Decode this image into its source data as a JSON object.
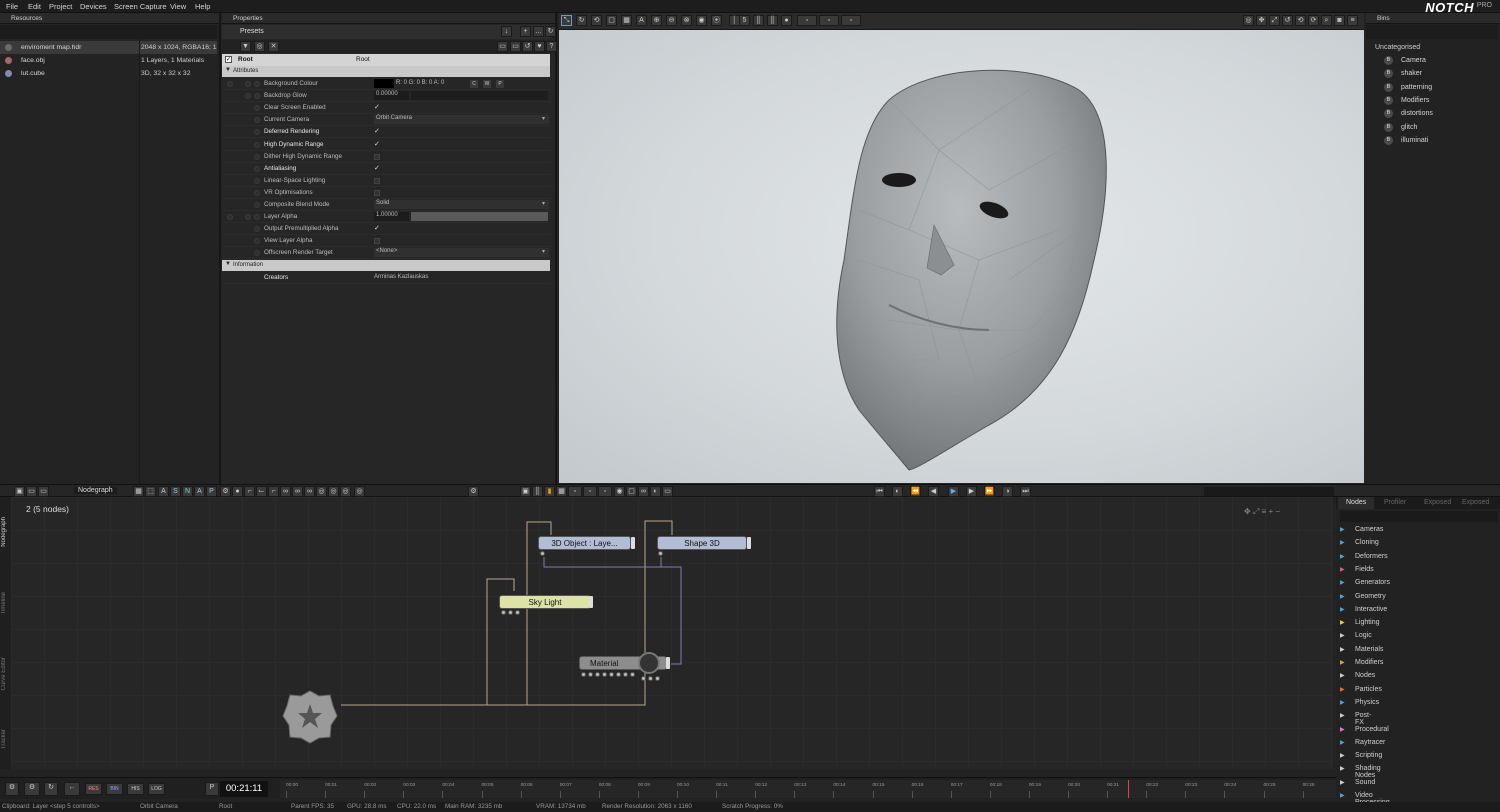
{
  "menu": [
    "File",
    "Edit",
    "Project",
    "Devices",
    "Screen Capture",
    "View",
    "Help"
  ],
  "logo": "NOTCH",
  "logo_sub": "PRO",
  "resources": {
    "title": "Resources",
    "items": [
      {
        "name": "enviroment map.hdr",
        "info": "2048 x 1024, RGBA16; 1"
      },
      {
        "name": "face.obj",
        "info": "1 Layers, 1 Materials"
      },
      {
        "name": "lut.cube",
        "info": "3D, 32 x 32 x 32"
      }
    ]
  },
  "properties": {
    "title": "Properties",
    "presets": "Presets",
    "root_label": "Root",
    "root_value": "Root",
    "attributes_header": "Attributes",
    "rows": [
      {
        "label": "Background Colour",
        "value": "R: 0 G: 0 B: 0 A: 0",
        "bold": false
      },
      {
        "label": "Backdrop Glow",
        "value": "0.00000",
        "bold": false
      },
      {
        "label": "Clear Screen Enabled",
        "value": "✓",
        "bold": false
      },
      {
        "label": "Current Camera",
        "value": "Orbit Camera",
        "bold": false
      },
      {
        "label": "Deferred Rendering",
        "value": "✓",
        "bold": true
      },
      {
        "label": "High Dynamic Range",
        "value": "✓",
        "bold": true
      },
      {
        "label": "Dither High Dynamic Range",
        "value": "",
        "bold": false
      },
      {
        "label": "Antialiasing",
        "value": "✓",
        "bold": true
      },
      {
        "label": "Linear-Space Lighting",
        "value": "",
        "bold": false
      },
      {
        "label": "VR Optimisations",
        "value": "",
        "bold": false
      },
      {
        "label": "Composite Blend Mode",
        "value": "Solid",
        "bold": false
      },
      {
        "label": "Layer Alpha",
        "value": "1.00000",
        "bold": false
      },
      {
        "label": "Output Premultiplied Alpha",
        "value": "✓",
        "bold": false
      },
      {
        "label": "View Layer Alpha",
        "value": "",
        "bold": false
      },
      {
        "label": "Offscreen Render Target",
        "value": "<None>",
        "bold": false
      }
    ],
    "color_btns": [
      "C",
      "W",
      "P"
    ],
    "information_header": "Information",
    "creators_label": "Creators",
    "creators_value": "Arminas Kazlauskas"
  },
  "viewport_toolbar": {
    "num": "5"
  },
  "bins": {
    "title": "Bins",
    "uncategorised": "Uncategorised",
    "items": [
      "Camera",
      "shaker",
      "patterning",
      "Modifiers",
      "distortions",
      "glitch",
      "illuminati"
    ],
    "badge": "B"
  },
  "nodegraph": {
    "tab": "Nodegraph",
    "toolbar_letters": [
      "S",
      "N",
      "A",
      "P"
    ],
    "counter": "2  (5  nodes)",
    "nodes": [
      {
        "label": "3D  Object  :  Laye...",
        "color": "#a9b5cf"
      },
      {
        "label": "Shape  3D",
        "color": "#a9b5cf"
      },
      {
        "label": "Sky  Light",
        "color": "#d9dca0"
      },
      {
        "label": "Material",
        "color": "#8a8a8a"
      }
    ],
    "vtabs": [
      "Nodegraph",
      "Timeline",
      "Curve Editor",
      "Tracker"
    ]
  },
  "nodes_panel": {
    "tabs": [
      "Nodes",
      "Profiler",
      "Exposed",
      "Exposed"
    ],
    "items": [
      {
        "label": "Cameras",
        "color": "#4aa3df"
      },
      {
        "label": "Cloning",
        "color": "#4aa3df"
      },
      {
        "label": "Deformers",
        "color": "#4aa3df"
      },
      {
        "label": "Fields",
        "color": "#e05a8a"
      },
      {
        "label": "Generators",
        "color": "#4aa3df"
      },
      {
        "label": "Geometry",
        "color": "#4aa3df"
      },
      {
        "label": "Interactive",
        "color": "#4aa3df"
      },
      {
        "label": "Lighting",
        "color": "#e0d24a"
      },
      {
        "label": "Logic",
        "color": "#cfcfcf"
      },
      {
        "label": "Materials",
        "color": "#cfcfcf"
      },
      {
        "label": "Modifiers",
        "color": "#e0a040"
      },
      {
        "label": "Nodes",
        "color": "#cfcfcf"
      },
      {
        "label": "Particles",
        "color": "#e0703a"
      },
      {
        "label": "Physics",
        "color": "#4aa3df"
      },
      {
        "label": "Post-FX",
        "color": "#cfcfcf"
      },
      {
        "label": "Procedural",
        "color": "#e07ad0"
      },
      {
        "label": "Raytracer",
        "color": "#4aa3df"
      },
      {
        "label": "Scripting",
        "color": "#cfcfcf"
      },
      {
        "label": "Shading Nodes",
        "color": "#cfcfcf"
      },
      {
        "label": "Sound",
        "color": "#cfcfcf"
      },
      {
        "label": "Video Processing",
        "color": "#4aa3df"
      }
    ]
  },
  "timeline": {
    "time": "00:21:11",
    "buttons": [
      "RES",
      "BIN",
      "HIS",
      "LOG"
    ],
    "ticks": [
      "00:00",
      "00:01",
      "00:02",
      "00:03",
      "00:04",
      "00:05",
      "00:06",
      "00:07",
      "00:08",
      "00:09",
      "00:10",
      "00:11",
      "00:12",
      "00:13",
      "00:14",
      "00:15",
      "00:16",
      "00:17",
      "00:18",
      "00:19",
      "00:20",
      "00:21",
      "00:22",
      "00:23",
      "00:24",
      "00:25",
      "00:26"
    ]
  },
  "status": [
    "Clipboard: Layer <step 5 controlls>",
    "Orbit Camera",
    "Root",
    "Parent FPS: 35",
    "GPU: 28.8 ms",
    "CPU: 22.0 ms",
    "Main RAM: 3235 mb",
    "VRAM: 13734 mb",
    "Render Resolution: 2063 x 1160",
    "Scratch Progress: 0%"
  ]
}
